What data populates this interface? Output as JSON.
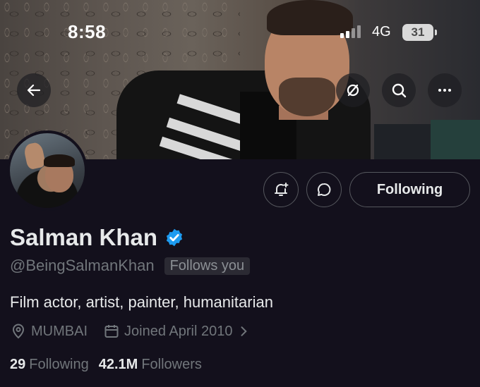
{
  "status_bar": {
    "time": "8:58",
    "network": "4G",
    "battery": "31"
  },
  "profile": {
    "name": "Salman Khan",
    "handle": "@BeingSalmanKhan",
    "follows_you": "Follows you",
    "bio": "Film actor, artist, painter, humanitarian",
    "location": "MUMBAI",
    "joined": "Joined April 2010",
    "following_count": "29",
    "following_label": "Following",
    "followers_count": "42.1M",
    "followers_label": "Followers"
  },
  "actions": {
    "follow_label": "Following"
  },
  "icons": {
    "back": "arrow-left-icon",
    "hide": "eye-slash-icon",
    "search": "search-icon",
    "more": "more-horizontal-icon",
    "notify": "bell-plus-icon",
    "message": "chat-bubble-icon",
    "verified": "verified-badge-icon",
    "location": "location-pin-icon",
    "calendar": "calendar-icon"
  },
  "colors": {
    "background": "#13101c",
    "verified": "#1d9bf0",
    "text": "#e7e9ea",
    "muted": "#71767b"
  }
}
